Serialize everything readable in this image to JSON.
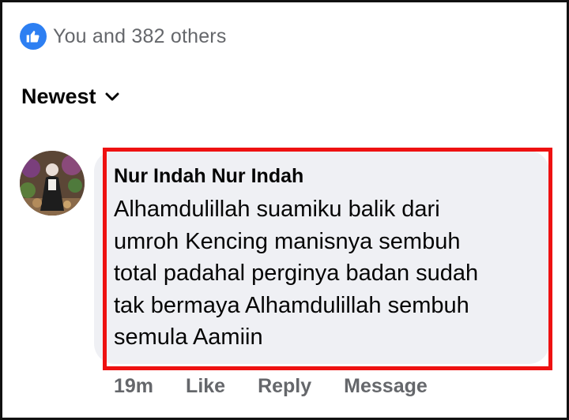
{
  "reactions": {
    "icon": "thumbs-up-icon",
    "color": "#2d7ff2",
    "summary": "You and 382 others"
  },
  "sort": {
    "label": "Newest",
    "icon": "chevron-down-icon"
  },
  "comment": {
    "author": "Nur Indah Nur Indah",
    "text_lines": [
      "Alhamdulillah suamiku balik dari",
      "umroh Kencing manisnya sembuh",
      "total padahal perginya badan sudah",
      "tak bermaya Alhamdulillah sembuh",
      "semula Aamiin"
    ],
    "highlight_color": "#ee1111",
    "bubble_color": "#eff0f4"
  },
  "actions": {
    "time": "19m",
    "like": "Like",
    "reply": "Reply",
    "message": "Message"
  }
}
